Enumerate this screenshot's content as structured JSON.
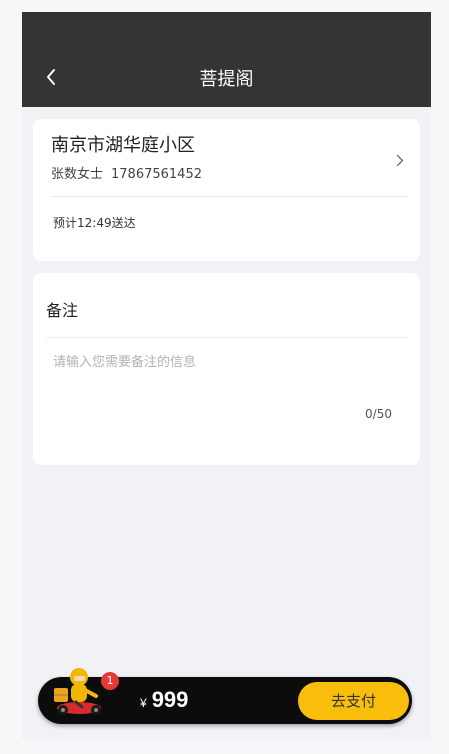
{
  "header": {
    "title": "菩提阁",
    "back_icon": "chevron-left-icon"
  },
  "address": {
    "location": "南京市湖华庭小区",
    "contact_name": "张数女士",
    "phone": "17867561452",
    "eta": "预计12:49送达"
  },
  "note": {
    "title": "备注",
    "placeholder": "请输入您需要备注的信息",
    "counter": "0/50"
  },
  "checkout": {
    "badge_count": "1",
    "currency": "¥",
    "amount": "999",
    "pay_label": "去支付"
  },
  "colors": {
    "header_bg": "#343434",
    "accent": "#f9be0b",
    "badge": "#e53935",
    "bar_bg": "#0c0c0c"
  }
}
